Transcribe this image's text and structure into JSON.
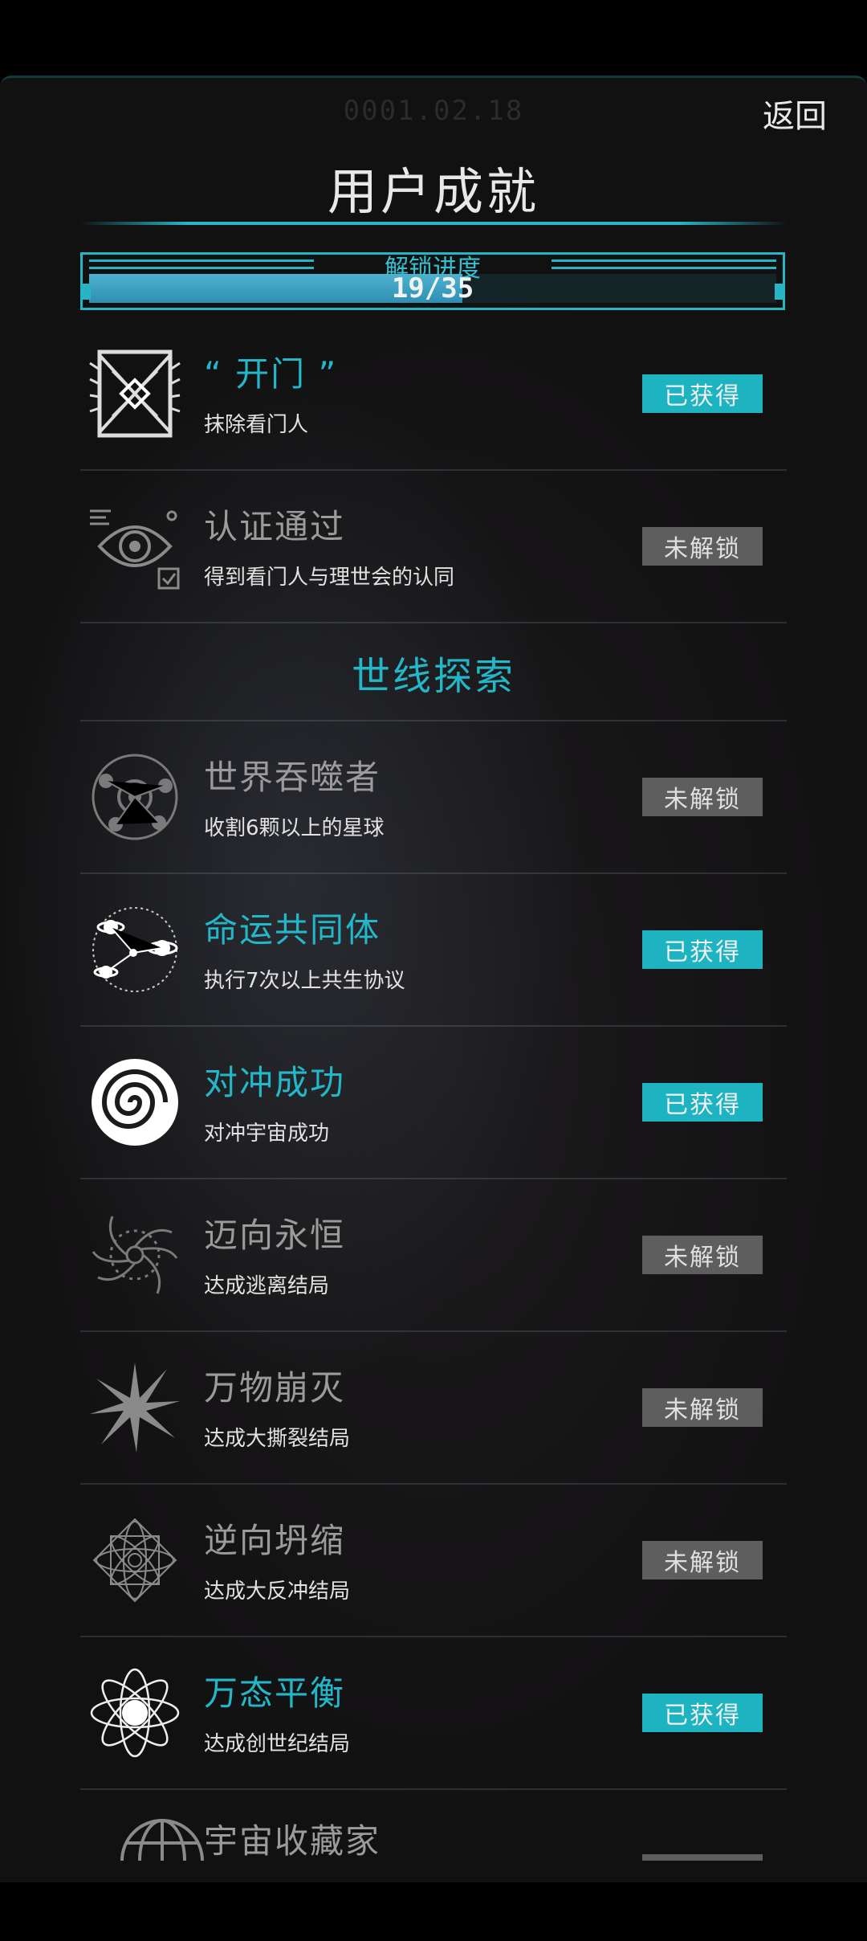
{
  "header": {
    "date": "0001.02.18",
    "back_label": "返回",
    "title": "用户成就"
  },
  "progress": {
    "label": "解锁进度",
    "text": "19/35",
    "unlocked": 19,
    "total": 35
  },
  "colors": {
    "accent": "#22b8c9",
    "badge_got": "#1eb3c1",
    "badge_locked": "#5e5e5e",
    "name_locked": "#9b9b9b"
  },
  "achievements_top": [
    {
      "name": "“ 开门 ”",
      "desc": "抹除看门人",
      "status": "已获得",
      "icon": "gate-icon"
    },
    {
      "name": "认证通过",
      "desc": "得到看门人与理世会的认同",
      "status": "未解锁",
      "icon": "eye-verify-icon"
    }
  ],
  "section": {
    "title": "世线探索"
  },
  "achievements": [
    {
      "name": "世界吞噬者",
      "desc": "收割6颗以上的星球",
      "status": "未解锁",
      "icon": "planet-orbit-icon"
    },
    {
      "name": "命运共同体",
      "desc": "执行7次以上共生协议",
      "status": "已获得",
      "icon": "linked-planets-icon"
    },
    {
      "name": "对冲成功",
      "desc": "对冲宇宙成功",
      "status": "已获得",
      "icon": "spiral-icon"
    },
    {
      "name": "迈向永恒",
      "desc": "达成逃离结局",
      "status": "未解锁",
      "icon": "vortex-icon"
    },
    {
      "name": "万物崩灭",
      "desc": "达成大撕裂结局",
      "status": "未解锁",
      "icon": "burst-icon"
    },
    {
      "name": "逆向坍缩",
      "desc": "达成大反冲结局",
      "status": "未解锁",
      "icon": "mandala-icon"
    },
    {
      "name": "万态平衡",
      "desc": "达成创世纪结局",
      "status": "已获得",
      "icon": "atom-icon"
    },
    {
      "name": "宇宙收藏家",
      "desc": "",
      "status": "",
      "icon": "dome-icon"
    }
  ]
}
